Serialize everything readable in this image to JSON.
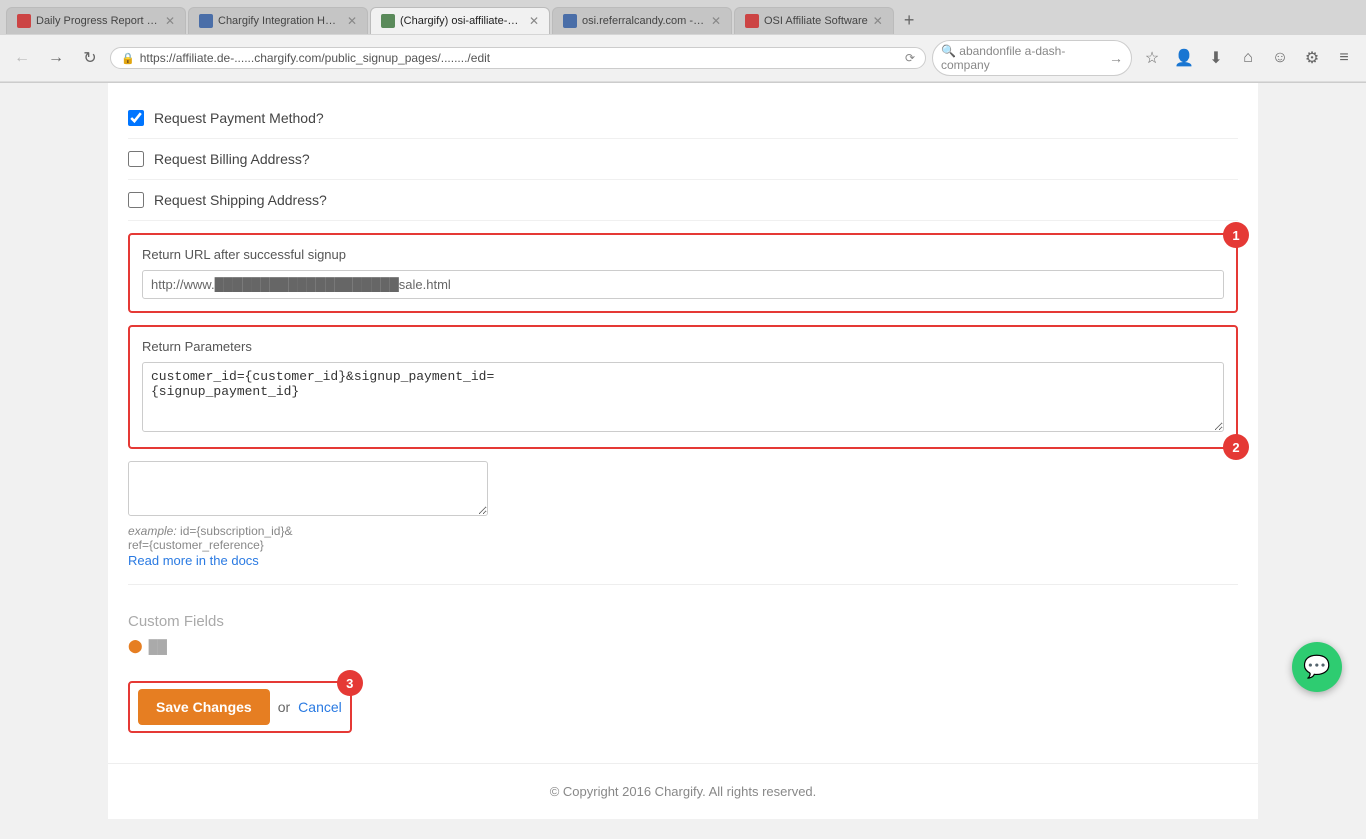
{
  "browser": {
    "tabs": [
      {
        "id": "t1",
        "label": "Daily Progress Report - s...",
        "favicon": "red",
        "active": false
      },
      {
        "id": "t2",
        "label": "Chargify Integration Hoo...",
        "favicon": "blue",
        "active": false
      },
      {
        "id": "t3",
        "label": "(Chargify) osi-affiliate-de...",
        "favicon": "green",
        "active": true
      },
      {
        "id": "t4",
        "label": "osi.referralcandy.com - s...",
        "favicon": "blue",
        "active": false
      },
      {
        "id": "t5",
        "label": "OSI Affiliate Software",
        "favicon": "red",
        "active": false
      }
    ],
    "address": "https://affiliate.de-......chargify.com/public_signup_pages/......../edit",
    "search_placeholder": "🔍 abandonfile a-dash-company"
  },
  "form": {
    "request_payment_label": "Request Payment Method?",
    "request_billing_label": "Request Billing Address?",
    "request_shipping_label": "Request Shipping Address?",
    "return_url_section": {
      "label": "Return URL after successful signup",
      "value": "http://www.████████████████████sale.html",
      "annotation": "1"
    },
    "return_params_section": {
      "label": "Return Parameters",
      "value": "customer_id={customer_id}&signup_payment_id=\n{signup_payment_id}",
      "annotation": "2"
    },
    "extra_textarea_placeholder": "",
    "example_text": "example: id={subscription_id}&\nref={customer_reference}",
    "read_more_label": "Read more in the docs",
    "custom_fields_label": "Custom Fields",
    "custom_field_item": "◉ ██",
    "save_button_label": "Save Changes",
    "or_text": "or",
    "cancel_label": "Cancel",
    "annotation_save": "3"
  },
  "footer": {
    "copyright": "© Copyright 2016 Chargify. All rights reserved."
  }
}
